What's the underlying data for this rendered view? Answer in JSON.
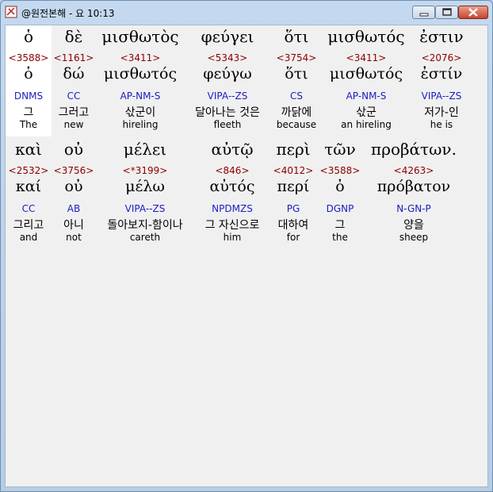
{
  "window": {
    "title": "@원전본해 - 요 10:13",
    "buttons": {
      "minimize": "minimize-icon",
      "maximize": "maximize-icon",
      "close": "close-icon"
    }
  },
  "rows": [
    {
      "words": [
        {
          "greek": "ὁ",
          "strong": "<3588>",
          "lemma": "ὁ",
          "morph": "DNMS",
          "korean": "그",
          "english": "The"
        },
        {
          "greek": "δὲ",
          "strong": "<1161>",
          "lemma": "δώ",
          "morph": "CC",
          "korean": "그러고",
          "english": "new"
        },
        {
          "greek": "μισθωτὸς",
          "strong": "<3411>",
          "lemma": "μισθωτός",
          "morph": "AP-NM-S",
          "korean": "삯군이",
          "english": "hireling"
        },
        {
          "greek": "φεύγει",
          "strong": "<5343>",
          "lemma": "φεύγω",
          "morph": "VIPA--ZS",
          "korean": "달아나는 것은",
          "english": "fleeth"
        },
        {
          "greek": "ὅτι",
          "strong": "<3754>",
          "lemma": "ὅτι",
          "morph": "CS",
          "korean": "까닭에",
          "english": "because"
        },
        {
          "greek": "μισθωτός",
          "strong": "<3411>",
          "lemma": "μισθωτός",
          "morph": "AP-NM-S",
          "korean": "삯군",
          "english": "an hireling"
        },
        {
          "greek": "ἐστιν",
          "strong": "<2076>",
          "lemma": "ἐστίν",
          "morph": "VIPA--ZS",
          "korean": "저가-인",
          "english": "he is"
        }
      ]
    },
    {
      "words": [
        {
          "greek": "καὶ",
          "strong": "<2532>",
          "lemma": "καί",
          "morph": "CC",
          "korean": "그리고",
          "english": "and"
        },
        {
          "greek": "οὐ",
          "strong": "<3756>",
          "lemma": "οὐ",
          "morph": "AB",
          "korean": "아니",
          "english": "not"
        },
        {
          "greek": "μέλει",
          "strong": "<*3199>",
          "lemma": "μέλω",
          "morph": "VIPA--ZS",
          "korean": "돌아보지-함이나",
          "english": "careth"
        },
        {
          "greek": "αὐτῷ",
          "strong": "<846>",
          "lemma": "αὐτός",
          "morph": "NPDMZS",
          "korean": "그 자신으로",
          "english": "him"
        },
        {
          "greek": "περὶ",
          "strong": "<4012>",
          "lemma": "περί",
          "morph": "PG",
          "korean": "대하여",
          "english": "for"
        },
        {
          "greek": "τῶν",
          "strong": "<3588>",
          "lemma": "ὁ",
          "morph": "DGNP",
          "korean": "그",
          "english": "the"
        },
        {
          "greek": "προβάτων.",
          "strong": "<4263>",
          "lemma": "πρόβατον",
          "morph": "N-GN-P",
          "korean": "양을",
          "english": "sheep"
        }
      ]
    }
  ]
}
